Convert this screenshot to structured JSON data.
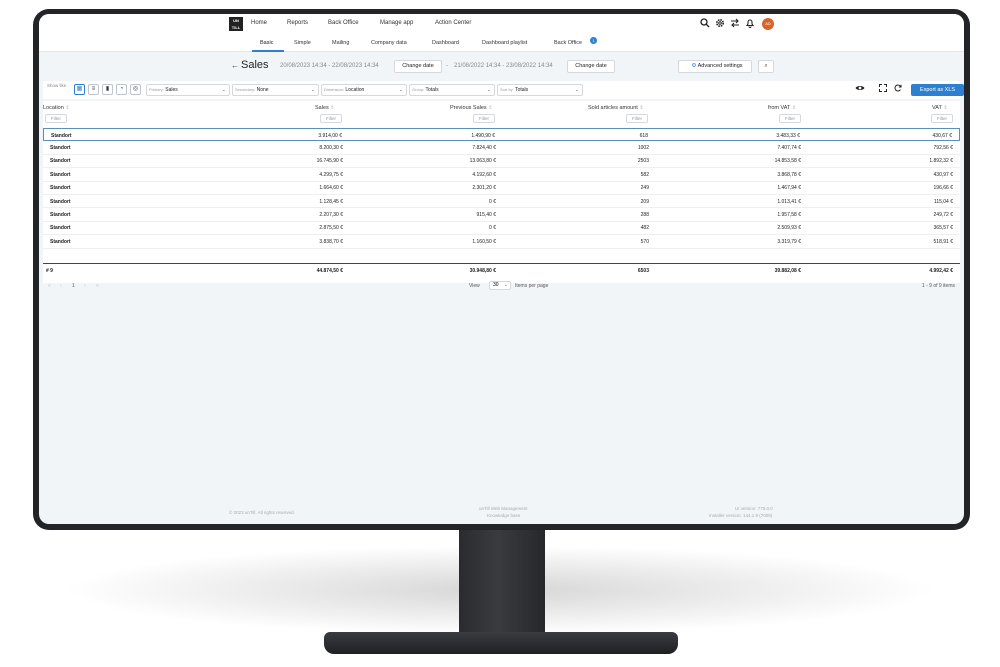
{
  "nav": {
    "logo": "UN TILL",
    "items": [
      "Home",
      "Reports",
      "Back Office",
      "Manage app",
      "Action Center"
    ],
    "avatar": "AD"
  },
  "subnav": {
    "items": [
      "Basic",
      "Simple",
      "Mailing",
      "Company data",
      "Dashboard",
      "Dashboard playlist",
      "Back Office"
    ],
    "badge": "1"
  },
  "titlebar": {
    "title": "Sales",
    "range1": "20/08/2023 14:34 - 22/08/2023 14:34",
    "change1": "Change date",
    "separator": "-",
    "range2": "21/08/2022 14:34 - 23/08/2022 14:34",
    "change2": "Change date",
    "advanced": "Advanced settings"
  },
  "toolbar": {
    "show_like": "Show like",
    "primary_label": "Primary:",
    "primary_value": "Sales",
    "secondary_label": "Secondary:",
    "secondary_value": "None",
    "dimension_label": "Dimension:",
    "dimension_value": "Location",
    "group_label": "Group:",
    "group_value": "Totals",
    "sortby_label": "Sort by:",
    "sortby_value": "Totals",
    "export": "Export as XLS"
  },
  "table": {
    "columns": [
      "Location",
      "Sales",
      "Previous Sales",
      "Sold articles amount",
      "from VAT",
      "VAT"
    ],
    "filter_placeholder": "Filter",
    "rows": [
      [
        "Standort",
        "3.914,00 €",
        "1.490,90 €",
        "618",
        "3.483,33 €",
        "430,67 €"
      ],
      [
        "Standort",
        "8.200,30 €",
        "7.824,40 €",
        "1002",
        "7.407,74 €",
        "792,56 €"
      ],
      [
        "Standort",
        "16.745,90 €",
        "13.063,80 €",
        "2503",
        "14.853,58 €",
        "1.892,32 €"
      ],
      [
        "Standort",
        "4.299,75 €",
        "4.192,60 €",
        "582",
        "3.868,78 €",
        "430,97 €"
      ],
      [
        "Standort",
        "1.664,60 €",
        "2.301,20 €",
        "249",
        "1.467,94 €",
        "196,66 €"
      ],
      [
        "Standort",
        "1.128,45 €",
        "0 €",
        "209",
        "1.013,41 €",
        "115,04 €"
      ],
      [
        "Standort",
        "2.207,30 €",
        "915,40 €",
        "288",
        "1.957,58 €",
        "249,72 €"
      ],
      [
        "Standort",
        "2.875,50 €",
        "0 €",
        "482",
        "2.509,93 €",
        "365,57 €"
      ],
      [
        "Standort",
        "3.838,70 €",
        "1.160,50 €",
        "570",
        "3.319,79 €",
        "518,91 €"
      ]
    ],
    "totals": [
      "# 9",
      "44.874,50 €",
      "30.948,80 €",
      "6503",
      "39.882,08 €",
      "4.992,42 €"
    ]
  },
  "pager": {
    "first": "«",
    "prev": "‹",
    "current": "1",
    "next": "›",
    "last": "»",
    "view_label": "View",
    "per_page": "30",
    "items_per_page": "Items per page",
    "summary": "1 - 9 of 9 items"
  },
  "footer": {
    "copyright": "© 2023 unTill. All rights reserved.",
    "app_name": "unTill Web Management",
    "knowledge": "Knowledge base",
    "ui_version": "UI version: 775.0.0",
    "installer_version": "Installer version: 144.1.9 (7009)"
  },
  "colors": {
    "accent": "#2f7fd0",
    "avatar": "#d8642c",
    "bezel": "#232427"
  }
}
